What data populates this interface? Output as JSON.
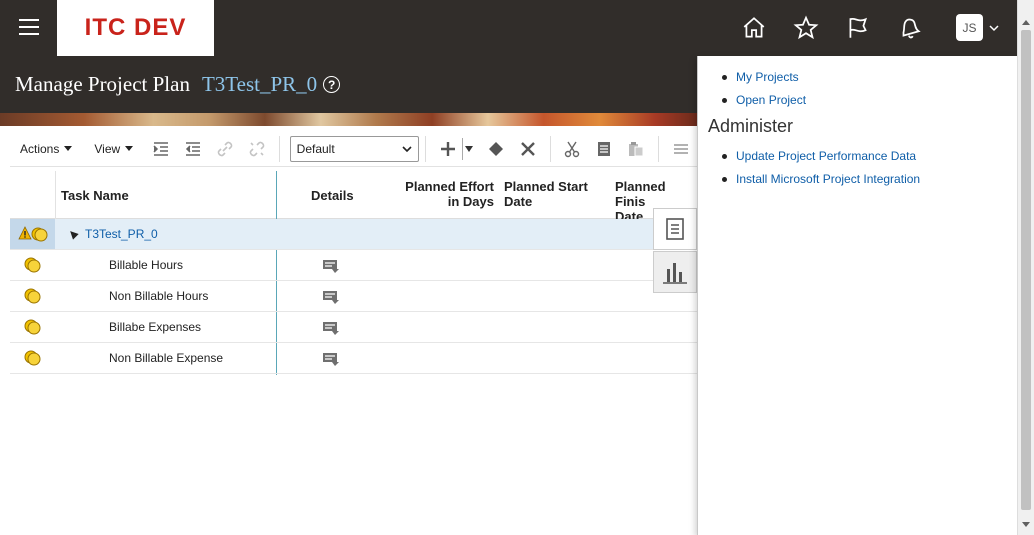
{
  "header": {
    "logo": "ITC DEV",
    "page_title": "Manage Project Plan",
    "project_name": "T3Test_PR_0",
    "help": "?",
    "avatar_initials": "JS"
  },
  "toolbar": {
    "actions_label": "Actions",
    "view_label": "View",
    "view_select_value": "Default"
  },
  "table": {
    "columns": {
      "task_name": "Task Name",
      "details": "Details",
      "planned_effort_line1": "Planned Effort",
      "planned_effort_line2": "in Days",
      "planned_start_line1": "Planned Start",
      "planned_start_line2": "Date",
      "planned_finish_line1": "Planned Finis",
      "planned_finish_line2": "Date"
    },
    "rows": [
      {
        "name": "T3Test_PR_0"
      },
      {
        "name": "Billable Hours"
      },
      {
        "name": "Non Billable Hours"
      },
      {
        "name": "Billabe Expenses"
      },
      {
        "name": "Non Billable Expense"
      }
    ]
  },
  "panel": {
    "links_top": [
      "My Projects",
      "Open Project"
    ],
    "section_title": "Administer",
    "links_admin": [
      "Update Project Performance Data",
      "Install Microsoft Project Integration"
    ]
  },
  "colors": {
    "header_bg": "#312d2a",
    "logo_red": "#c9231b",
    "link_blue": "#0f5ea8",
    "project_name_blue": "#8ec5ea",
    "column_divider": "#5aa7b8",
    "selected_row": "#e3eef7"
  },
  "icons": {
    "header": [
      "home-icon",
      "star-icon",
      "flag-icon",
      "bell-icon"
    ]
  }
}
